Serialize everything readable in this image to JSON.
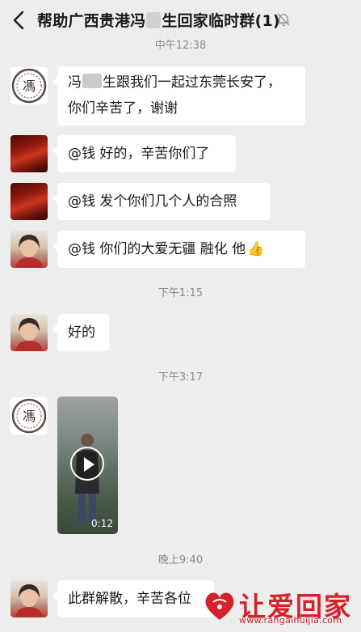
{
  "header": {
    "title_before": "帮助广西贵港冯",
    "title_after": "生回家临时群(1)",
    "back_icon": "back-chevron-icon",
    "mute_icon": "muted-bell-icon"
  },
  "top_time": "中午12:38",
  "messages": [
    {
      "avatar": "seal-avatar",
      "line1_before": "冯",
      "line1_after": "生跟我们一起过东莞长安了，",
      "line2": "你们辛苦了，谢谢"
    },
    {
      "avatar": "red-avatar",
      "text": "@钱  好的，辛苦你们了"
    },
    {
      "avatar": "red-avatar",
      "text": "@钱  发个你们几个人的合照"
    },
    {
      "avatar": "woman-avatar",
      "text": "@钱  你们的大爱无疆 融化 他",
      "emoji": "👍"
    },
    {
      "avatar": "woman-avatar",
      "text": "好的"
    },
    {
      "avatar": "seal-avatar",
      "video_duration": "0:12"
    },
    {
      "avatar": "woman-avatar",
      "text": "此群解散，辛苦各位"
    }
  ],
  "times": [
    "下午1:15",
    "下午3:17",
    "晚上9:40"
  ],
  "watermark": {
    "text": "让爱回家",
    "url": "www.rangaihuijia.com"
  },
  "colors": {
    "background": "#ededed",
    "bubble": "#ffffff",
    "watermark": "#d4222a"
  }
}
